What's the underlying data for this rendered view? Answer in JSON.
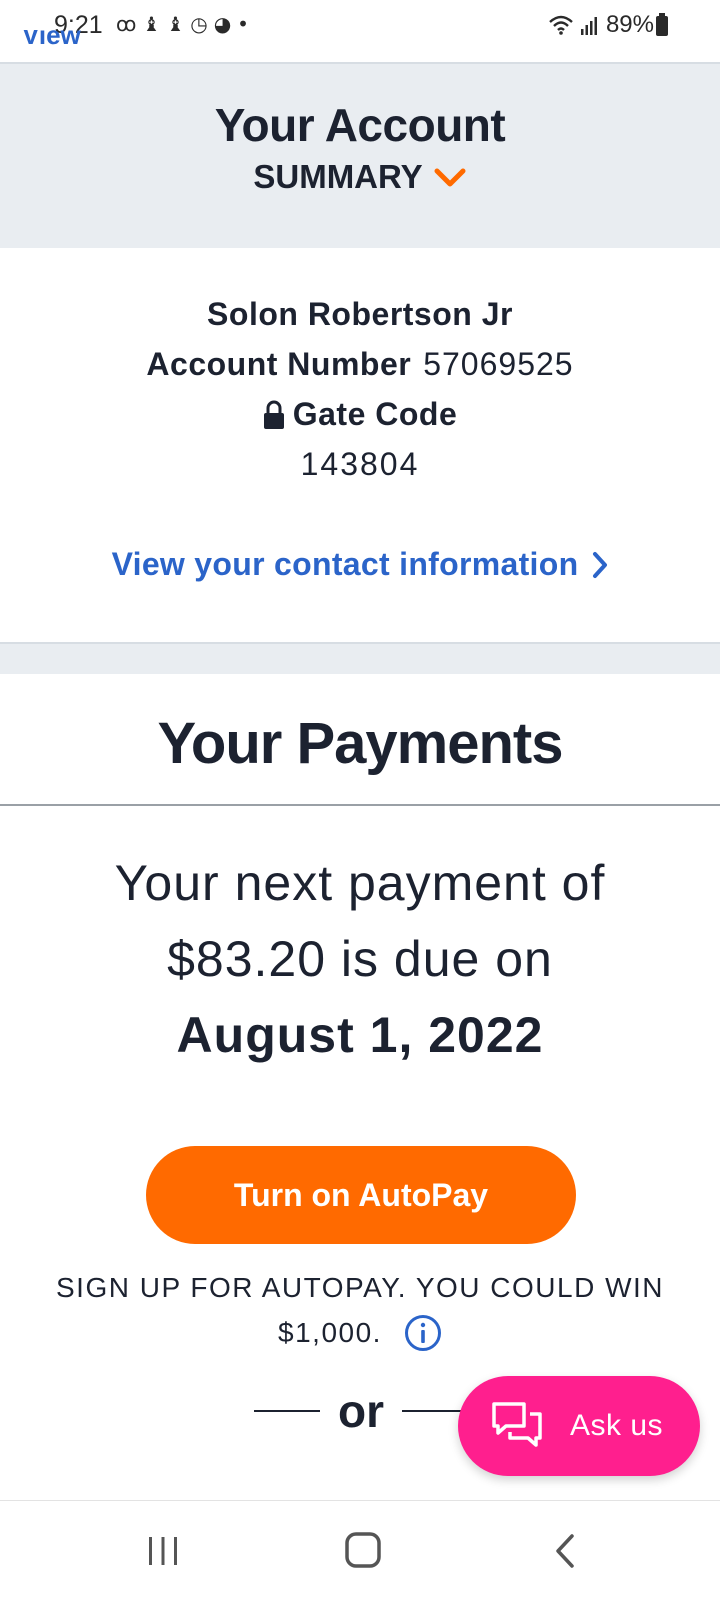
{
  "status_bar": {
    "time": "9:21",
    "left_icons": [
      "voicemail-icon",
      "notification-icon",
      "notification-icon",
      "clock-app-icon",
      "chrome-icon",
      "more-dot-icon"
    ],
    "battery": "89%"
  },
  "partial_top_link": "View",
  "account": {
    "title": "Your Account",
    "summary_label": "SUMMARY",
    "name": "Solon Robertson Jr",
    "account_number_label": "Account Number",
    "account_number": "57069525",
    "gate_code_label": "Gate Code",
    "gate_code": "143804",
    "contact_link": "View your contact information"
  },
  "payments": {
    "title": "Your Payments",
    "next_line1": "Your next payment of",
    "next_line2": "$83.20 is due on",
    "due_date": "August 1, 2022",
    "autopay_button": "Turn on AutoPay",
    "promo_line1": "SIGN UP FOR AUTOPAY. YOU COULD WIN",
    "promo_line2": "$1,000.",
    "or_label": "or"
  },
  "chat": {
    "label": "Ask us"
  },
  "colors": {
    "accent_orange": "#ff6a00",
    "link_blue": "#2b64c9",
    "chat_pink": "#ff1f8e",
    "text_dark": "#1c2230",
    "section_gray": "#e9edf1"
  }
}
